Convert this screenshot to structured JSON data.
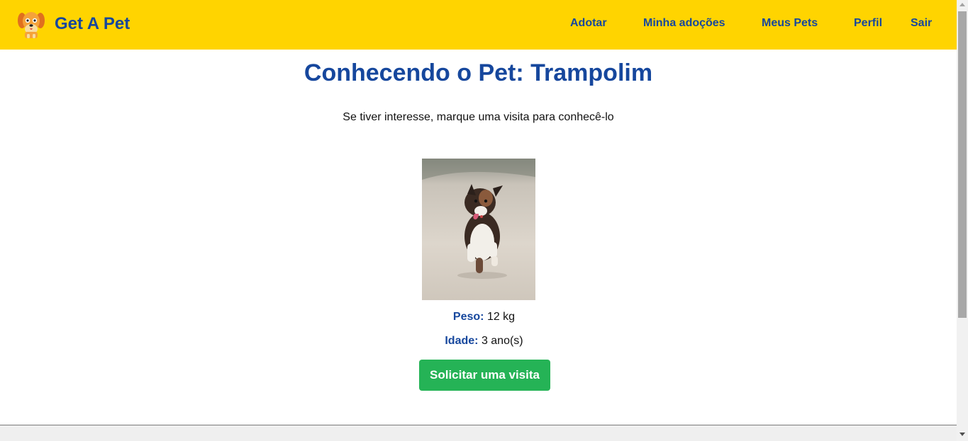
{
  "brand": {
    "name": "Get A Pet"
  },
  "nav": {
    "links": [
      {
        "label": "Adotar"
      },
      {
        "label": "Minha adoções"
      },
      {
        "label": "Meus Pets"
      },
      {
        "label": "Perfil"
      },
      {
        "label": "Sair"
      }
    ]
  },
  "main": {
    "title": "Conhecendo o Pet: Trampolim",
    "subtitle": "Se tiver interesse, marque uma visita para conhecê-lo",
    "pet_image_icon": "dog-photo",
    "weight": {
      "label": "Peso:",
      "value": "12 kg"
    },
    "age": {
      "label": "Idade:",
      "value": "3 ano(s)"
    },
    "visit_button_label": "Solicitar uma visita"
  },
  "colors": {
    "navbar": "#FFD400",
    "primary_text": "#16479d",
    "button": "#25b356"
  }
}
